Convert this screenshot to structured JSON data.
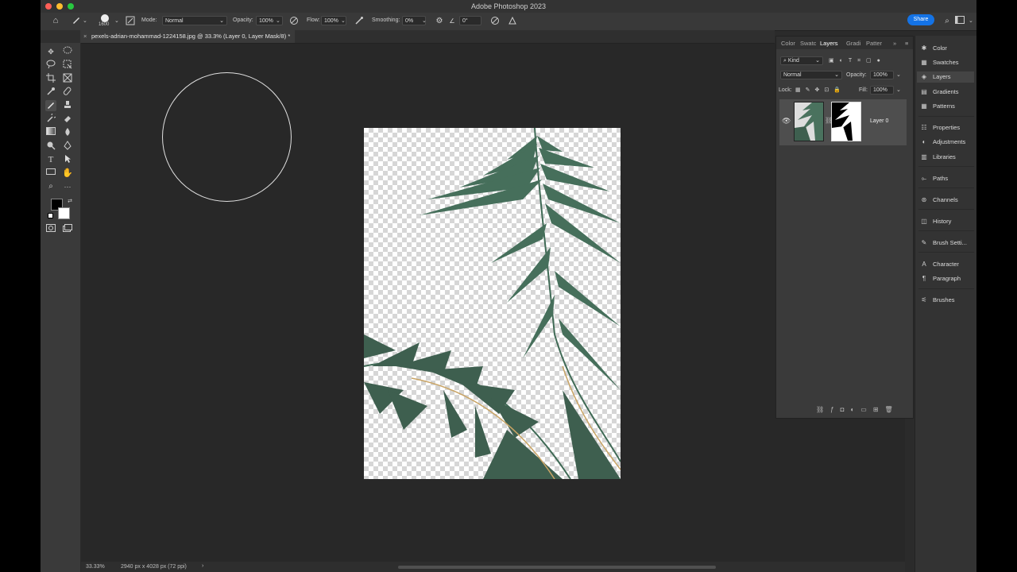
{
  "window": {
    "title": "Adobe Photoshop 2023"
  },
  "options_bar": {
    "brush_size": "1600",
    "mode_label": "Mode:",
    "mode_value": "Normal",
    "opacity_label": "Opacity:",
    "opacity_value": "100%",
    "flow_label": "Flow:",
    "flow_value": "100%",
    "smoothing_label": "Smoothing:",
    "smoothing_value": "0%",
    "angle_value": "0°",
    "share_label": "Share"
  },
  "document_tab": {
    "title": "pexels-adrian-mohammad-1224158.jpg @ 33.3% (Layer 0, Layer Mask/8) *"
  },
  "status_bar": {
    "zoom": "33.33%",
    "dimensions": "2940 px x 4028 px (72 ppi)"
  },
  "layers_panel": {
    "tabs": [
      "Color",
      "Swatc",
      "Layers",
      "Gradi",
      "Patter"
    ],
    "active_tab": "Layers",
    "filter_kind": "Kind",
    "blend_mode": "Normal",
    "opacity_label": "Opacity:",
    "opacity_value": "100%",
    "lock_label": "Lock:",
    "fill_label": "Fill:",
    "fill_value": "100%",
    "layers": [
      {
        "name": "Layer 0",
        "visible": true
      }
    ]
  },
  "dock_panels": {
    "items": [
      "Color",
      "Swatches",
      "Layers",
      "Gradients",
      "Patterns",
      "Properties",
      "Adjustments",
      "Libraries",
      "Paths",
      "Channels",
      "History",
      "Brush Setti...",
      "Character",
      "Paragraph",
      "Brushes"
    ],
    "active": "Layers"
  },
  "colors": {
    "foreground": "#000000",
    "background": "#ffffff",
    "accent": "#1473e6"
  }
}
